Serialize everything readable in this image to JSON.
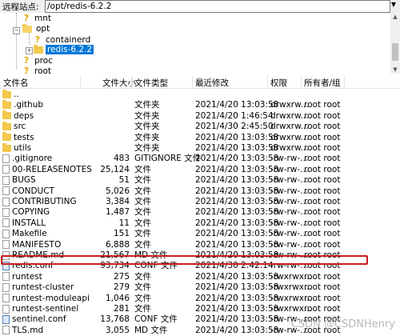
{
  "pathbar": {
    "label": "远程站点:",
    "path": "/opt/redis-6.2.2"
  },
  "tree": [
    {
      "label": "mnt",
      "icon": "question"
    },
    {
      "label": "opt",
      "icon": "folder-open"
    },
    {
      "label": "containerd",
      "icon": "question"
    },
    {
      "label": "redis-6.2.2",
      "icon": "folder",
      "selected": true
    },
    {
      "label": "proc",
      "icon": "question"
    },
    {
      "label": "root",
      "icon": "question"
    }
  ],
  "columns": {
    "name": "文件名",
    "size": "文件大小",
    "type": "文件类型",
    "modified": "最近修改",
    "perms": "权限",
    "owner": "所有者/组"
  },
  "rows": [
    {
      "name": "..",
      "size": "",
      "type": "",
      "modified": "",
      "perms": "",
      "owner": "",
      "icon": "folder"
    },
    {
      "name": ".github",
      "size": "",
      "type": "文件夹",
      "modified": "2021/4/20 13:03:58",
      "perms": "drwxrw...",
      "owner": "root root",
      "icon": "folder"
    },
    {
      "name": "deps",
      "size": "",
      "type": "文件夹",
      "modified": "2021/4/20 1:46:54",
      "perms": "drwxrw...",
      "owner": "root root",
      "icon": "folder"
    },
    {
      "name": "src",
      "size": "",
      "type": "文件夹",
      "modified": "2021/4/30 2:45:50",
      "perms": "drwxrw...",
      "owner": "root root",
      "icon": "folder"
    },
    {
      "name": "tests",
      "size": "",
      "type": "文件夹",
      "modified": "2021/4/20 13:03:58",
      "perms": "drwxrw...",
      "owner": "root root",
      "icon": "folder"
    },
    {
      "name": "utils",
      "size": "",
      "type": "文件夹",
      "modified": "2021/4/20 13:03:58",
      "perms": "drwxrw...",
      "owner": "root root",
      "icon": "folder"
    },
    {
      "name": ".gitignore",
      "size": "483",
      "type": "GITIGNORE 文件",
      "modified": "2021/4/20 13:03:58",
      "perms": "-rw-rw-...",
      "owner": "root root",
      "icon": "file"
    },
    {
      "name": "00-RELEASENOTES",
      "size": "25,124",
      "type": "文件",
      "modified": "2021/4/20 13:03:58",
      "perms": "-rw-rw-...",
      "owner": "root root",
      "icon": "file"
    },
    {
      "name": "BUGS",
      "size": "51",
      "type": "文件",
      "modified": "2021/4/20 13:03:58",
      "perms": "-rw-rw-...",
      "owner": "root root",
      "icon": "file"
    },
    {
      "name": "CONDUCT",
      "size": "5,026",
      "type": "文件",
      "modified": "2021/4/20 13:03:58",
      "perms": "-rw-rw-...",
      "owner": "root root",
      "icon": "file"
    },
    {
      "name": "CONTRIBUTING",
      "size": "3,384",
      "type": "文件",
      "modified": "2021/4/20 13:03:58",
      "perms": "-rw-rw-...",
      "owner": "root root",
      "icon": "file"
    },
    {
      "name": "COPYING",
      "size": "1,487",
      "type": "文件",
      "modified": "2021/4/20 13:03:58",
      "perms": "-rw-rw-...",
      "owner": "root root",
      "icon": "file"
    },
    {
      "name": "INSTALL",
      "size": "11",
      "type": "文件",
      "modified": "2021/4/20 13:03:58",
      "perms": "-rw-rw-...",
      "owner": "root root",
      "icon": "file"
    },
    {
      "name": "Makefile",
      "size": "151",
      "type": "文件",
      "modified": "2021/4/20 13:03:58",
      "perms": "-rw-rw-...",
      "owner": "root root",
      "icon": "file"
    },
    {
      "name": "MANIFESTO",
      "size": "6,888",
      "type": "文件",
      "modified": "2021/4/20 13:03:58",
      "perms": "-rw-rw-...",
      "owner": "root root",
      "icon": "file"
    },
    {
      "name": "README.md",
      "size": "21,567",
      "type": "MD 文件",
      "modified": "2021/4/20 13:03:58",
      "perms": "-rw-rw-...",
      "owner": "root root",
      "icon": "file"
    },
    {
      "name": "redis.conf",
      "size": "93,734",
      "type": "CONF 文件",
      "modified": "2021/4/30 2:42:14",
      "perms": "-rw-rw-...",
      "owner": "root root",
      "icon": "conf",
      "highlighted": true
    },
    {
      "name": "runtest",
      "size": "275",
      "type": "文件",
      "modified": "2021/4/20 13:03:58",
      "perms": "-rwxrwx...",
      "owner": "root root",
      "icon": "file"
    },
    {
      "name": "runtest-cluster",
      "size": "279",
      "type": "文件",
      "modified": "2021/4/20 13:03:58",
      "perms": "-rwxrwx...",
      "owner": "root root",
      "icon": "file"
    },
    {
      "name": "runtest-moduleapi",
      "size": "1,046",
      "type": "文件",
      "modified": "2021/4/20 13:03:58",
      "perms": "-rwxrwx...",
      "owner": "root root",
      "icon": "file"
    },
    {
      "name": "runtest-sentinel",
      "size": "281",
      "type": "文件",
      "modified": "2021/4/20 13:03:58",
      "perms": "-rwxrwx...",
      "owner": "root root",
      "icon": "file"
    },
    {
      "name": "sentinel.conf",
      "size": "13,768",
      "type": "CONF 文件",
      "modified": "2021/4/20 13:03:58",
      "perms": "-rw-rw-...",
      "owner": "root root",
      "icon": "conf"
    },
    {
      "name": "TLS.md",
      "size": "3,055",
      "type": "MD 文件",
      "modified": "2021/4/20 13:03:58",
      "perms": "-rw-rw-...",
      "owner": "root root",
      "icon": "file"
    }
  ],
  "watermark": "CSDN @CSDNHenry"
}
